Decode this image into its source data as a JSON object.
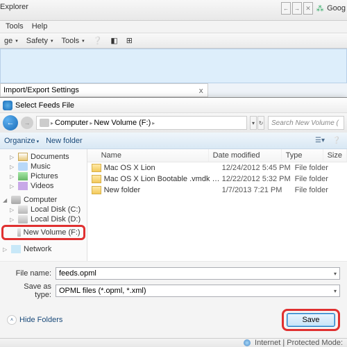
{
  "browser": {
    "title_fragment": "Explorer",
    "search_fragment": "Goog",
    "menus": [
      "Tools",
      "Help"
    ],
    "toolbar": {
      "page": "ge",
      "safety": "Safety",
      "tools": "Tools"
    }
  },
  "wizard_title": "Import/Export Settings",
  "dialog": {
    "title": "Select Feeds File",
    "breadcrumb": {
      "root": "Computer",
      "current": "New Volume (F:)"
    },
    "search_placeholder": "Search New Volume (",
    "organize": "Organize",
    "new_folder": "New folder",
    "nav": {
      "libraries": [
        "Documents",
        "Music",
        "Pictures",
        "Videos"
      ],
      "computer_label": "Computer",
      "drives": [
        "Local Disk (C:)",
        "Local Disk (D:)",
        "New Volume (F:)"
      ],
      "network_label": "Network"
    },
    "columns": {
      "name": "Name",
      "date": "Date modified",
      "type": "Type",
      "size": "Size"
    },
    "files": [
      {
        "name": "Mac OS X Lion",
        "date": "12/24/2012 5:45 PM",
        "type": "File folder"
      },
      {
        "name": "Mac OS X Lion Bootable .vmdk (For VMw...",
        "date": "12/22/2012 5:32 PM",
        "type": "File folder"
      },
      {
        "name": "New folder",
        "date": "1/7/2013 7:21 PM",
        "type": "File folder"
      }
    ],
    "filename_label": "File name:",
    "filename_value": "feeds.opml",
    "saveas_label": "Save as type:",
    "saveas_value": "OPML files (*.opml, *.xml)",
    "hide_folders": "Hide Folders",
    "save": "Save"
  },
  "status": {
    "text": "Internet | Protected Mode:"
  }
}
